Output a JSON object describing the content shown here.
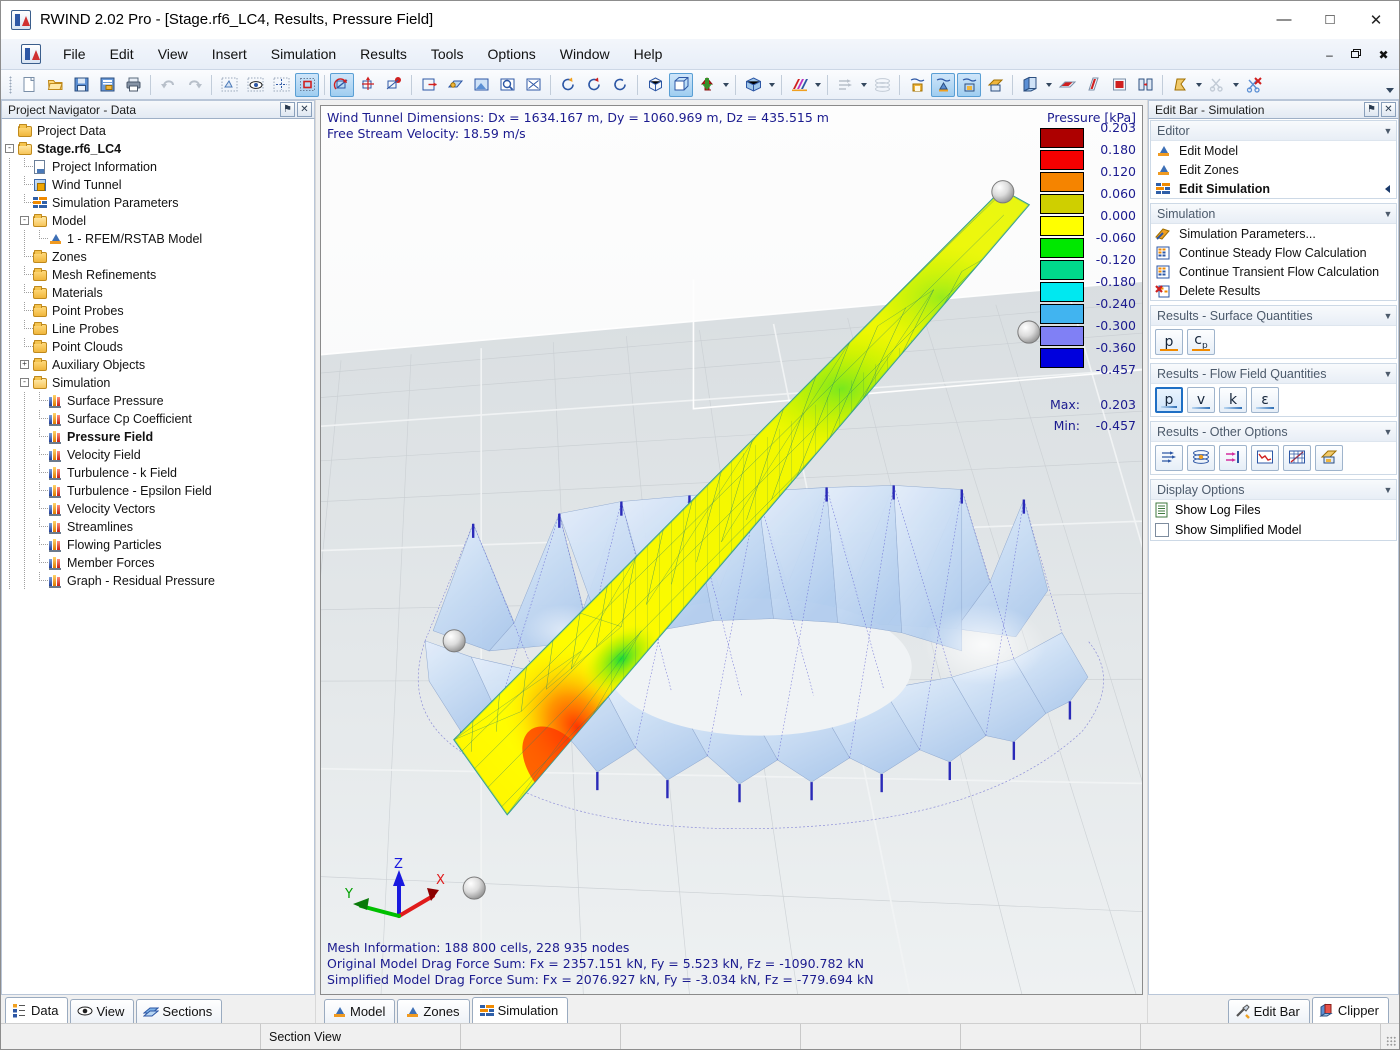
{
  "window": {
    "title": "RWIND 2.02 Pro - [Stage.rf6_LC4, Results, Pressure Field]",
    "app_icon": "rwind-icon",
    "minimize": "—",
    "maximize": "□",
    "close": "✕"
  },
  "mdi": {
    "minimize": "–",
    "restore": "❐",
    "close": "✖"
  },
  "menu": {
    "items": [
      {
        "label": "File"
      },
      {
        "label": "Edit"
      },
      {
        "label": "View"
      },
      {
        "label": "Insert"
      },
      {
        "label": "Simulation"
      },
      {
        "label": "Results"
      },
      {
        "label": "Tools"
      },
      {
        "label": "Options"
      },
      {
        "label": "Window"
      },
      {
        "label": "Help"
      }
    ]
  },
  "toolbar": {
    "groups": [
      {
        "buttons": [
          {
            "name": "new-file-button",
            "icon": "new-document-icon",
            "state": "normal"
          },
          {
            "name": "open-file-button",
            "icon": "open-folder-icon",
            "state": "normal"
          },
          {
            "name": "save-button",
            "icon": "floppy-save-icon",
            "state": "normal"
          },
          {
            "name": "save-detail-button",
            "icon": "save-details-icon",
            "state": "normal"
          },
          {
            "name": "print-button",
            "icon": "printer-icon",
            "state": "normal"
          }
        ]
      },
      {
        "buttons": [
          {
            "name": "undo-button",
            "icon": "undo-arrow-icon",
            "state": "disabled"
          },
          {
            "name": "redo-button",
            "icon": "redo-arrow-icon",
            "state": "disabled"
          }
        ]
      },
      {
        "buttons": [
          {
            "name": "select-objects-button",
            "icon": "select-dots-icon",
            "state": "normal"
          },
          {
            "name": "select-visible-button",
            "icon": "select-eye-icon",
            "state": "normal"
          },
          {
            "name": "snap-grid-button",
            "icon": "snap-grid-icon",
            "state": "normal"
          },
          {
            "name": "selection-window-button",
            "icon": "selection-window-icon",
            "state": "active"
          }
        ]
      },
      {
        "buttons": [
          {
            "name": "rotate-view-button",
            "icon": "rotate-axes-icon",
            "state": "active"
          },
          {
            "name": "pan-view-button",
            "icon": "move-axes-icon",
            "state": "normal"
          },
          {
            "name": "orbit-view-button",
            "icon": "orbit-axes-icon",
            "state": "normal"
          }
        ]
      },
      {
        "buttons": [
          {
            "name": "view-box-button",
            "icon": "view-box-icon",
            "state": "normal"
          },
          {
            "name": "render-view-button",
            "icon": "render-shade-icon",
            "state": "normal"
          },
          {
            "name": "zoom-window-button",
            "icon": "zoom-window-icon",
            "state": "normal"
          },
          {
            "name": "zoom-select-button",
            "icon": "zoom-magnifier-icon",
            "state": "normal"
          },
          {
            "name": "zoom-all-button",
            "icon": "zoom-fit-icon",
            "state": "normal"
          }
        ]
      },
      {
        "buttons": [
          {
            "name": "rotate-left-button",
            "icon": "rotate-ccw-icon",
            "state": "normal"
          },
          {
            "name": "rotate-right-button",
            "icon": "rotate-cw-icon",
            "state": "normal"
          },
          {
            "name": "rotate-reset-button",
            "icon": "rotate-reset-icon",
            "state": "normal"
          }
        ]
      },
      {
        "buttons": [
          {
            "name": "iso-view-button",
            "icon": "isometric-cube-icon",
            "state": "normal"
          },
          {
            "name": "perspective-view-button",
            "icon": "perspective-cube-icon",
            "state": "active"
          },
          {
            "name": "view-direction-button",
            "icon": "view-direction-icon",
            "state": "normal",
            "dropdown": true
          }
        ]
      },
      {
        "buttons": [
          {
            "name": "display-cube-button",
            "icon": "display-cube-icon",
            "state": "normal",
            "dropdown": true
          }
        ]
      },
      {
        "buttons": [
          {
            "name": "color-scale-button",
            "icon": "color-stripes-icon",
            "state": "normal",
            "dropdown": true
          }
        ]
      },
      {
        "buttons": [
          {
            "name": "flow-arrows-button",
            "icon": "flow-arrows-icon",
            "state": "disabled",
            "dropdown": true
          },
          {
            "name": "streamlines-button",
            "icon": "streamline-layers-icon",
            "state": "disabled"
          }
        ]
      },
      {
        "buttons": [
          {
            "name": "show-model-button",
            "icon": "model-wind-icon",
            "state": "normal"
          },
          {
            "name": "show-supports-button",
            "icon": "supports-wind-icon",
            "state": "active"
          },
          {
            "name": "show-zones-button",
            "icon": "zones-wind-icon",
            "state": "active"
          },
          {
            "name": "render-results-button",
            "icon": "render-results-icon",
            "state": "normal"
          }
        ]
      },
      {
        "buttons": [
          {
            "name": "clipper-box-button",
            "icon": "clipper-box-icon",
            "state": "normal",
            "dropdown": true
          },
          {
            "name": "section-plane-xy-button",
            "icon": "plane-xy-icon",
            "state": "normal"
          },
          {
            "name": "section-plane-yz-button",
            "icon": "plane-yz-icon",
            "state": "normal"
          },
          {
            "name": "section-plane-xz-button",
            "icon": "plane-xz-icon",
            "state": "normal"
          },
          {
            "name": "section-move-button",
            "icon": "section-move-icon",
            "state": "normal"
          }
        ]
      },
      {
        "buttons": [
          {
            "name": "clip-shape-button",
            "icon": "clip-shape-icon",
            "state": "normal",
            "dropdown": true
          },
          {
            "name": "cut-tool-button",
            "icon": "scissors-icon",
            "state": "disabled",
            "dropdown": true
          },
          {
            "name": "delete-cut-button",
            "icon": "delete-scissors-icon",
            "state": "normal"
          }
        ]
      }
    ],
    "overflow": "overflow-chevron-icon"
  },
  "navigator": {
    "caption": "Project Navigator - Data",
    "pin_glyph": "⚑",
    "close_glyph": "✕",
    "tree": [
      {
        "label": "Project Data",
        "depth": 0,
        "icon": "folder-icon",
        "expander": "",
        "bold": false
      },
      {
        "label": "Stage.rf6_LC4",
        "depth": 0,
        "icon": "folder-open-icon",
        "expander": "-",
        "bold": true
      },
      {
        "label": "Project Information",
        "depth": 1,
        "icon": "document-icon",
        "expander": "",
        "bold": false
      },
      {
        "label": "Wind Tunnel",
        "depth": 1,
        "icon": "wind-tunnel-cube-icon",
        "expander": "",
        "bold": false
      },
      {
        "label": "Simulation Parameters",
        "depth": 1,
        "icon": "simulation-params-icon",
        "expander": "",
        "bold": false
      },
      {
        "label": "Model",
        "depth": 1,
        "icon": "folder-open-icon",
        "expander": "-",
        "bold": false
      },
      {
        "label": "1 - RFEM/RSTAB Model",
        "depth": 2,
        "icon": "support-icon",
        "expander": "",
        "bold": false
      },
      {
        "label": "Zones",
        "depth": 1,
        "icon": "folder-icon",
        "expander": "",
        "bold": false
      },
      {
        "label": "Mesh Refinements",
        "depth": 1,
        "icon": "folder-icon",
        "expander": "",
        "bold": false
      },
      {
        "label": "Materials",
        "depth": 1,
        "icon": "folder-icon",
        "expander": "",
        "bold": false
      },
      {
        "label": "Point Probes",
        "depth": 1,
        "icon": "folder-icon",
        "expander": "",
        "bold": false
      },
      {
        "label": "Line Probes",
        "depth": 1,
        "icon": "folder-icon",
        "expander": "",
        "bold": false
      },
      {
        "label": "Point Clouds",
        "depth": 1,
        "icon": "folder-icon",
        "expander": "",
        "bold": false
      },
      {
        "label": "Auxiliary Objects",
        "depth": 1,
        "icon": "folder-icon",
        "expander": "+",
        "bold": false
      },
      {
        "label": "Simulation",
        "depth": 1,
        "icon": "folder-open-icon",
        "expander": "-",
        "bold": false
      },
      {
        "label": "Surface Pressure",
        "depth": 2,
        "icon": "result-bars-icon",
        "expander": "",
        "bold": false
      },
      {
        "label": "Surface Cp Coefficient",
        "depth": 2,
        "icon": "result-bars-icon",
        "expander": "",
        "bold": false
      },
      {
        "label": "Pressure Field",
        "depth": 2,
        "icon": "result-bars-icon",
        "expander": "",
        "bold": true
      },
      {
        "label": "Velocity Field",
        "depth": 2,
        "icon": "result-bars-icon",
        "expander": "",
        "bold": false
      },
      {
        "label": "Turbulence - k Field",
        "depth": 2,
        "icon": "result-bars-icon",
        "expander": "",
        "bold": false
      },
      {
        "label": "Turbulence - Epsilon Field",
        "depth": 2,
        "icon": "result-bars-icon",
        "expander": "",
        "bold": false
      },
      {
        "label": "Velocity Vectors",
        "depth": 2,
        "icon": "result-bars-icon",
        "expander": "",
        "bold": false
      },
      {
        "label": "Streamlines",
        "depth": 2,
        "icon": "result-bars-icon",
        "expander": "",
        "bold": false
      },
      {
        "label": "Flowing Particles",
        "depth": 2,
        "icon": "result-bars-icon",
        "expander": "",
        "bold": false
      },
      {
        "label": "Member Forces",
        "depth": 2,
        "icon": "result-bars-icon",
        "expander": "",
        "bold": false
      },
      {
        "label": "Graph - Residual Pressure",
        "depth": 2,
        "icon": "result-bars-icon",
        "expander": "",
        "bold": false
      }
    ],
    "tabs": [
      {
        "label": "Data",
        "icon": "tree-data-icon",
        "selected": true
      },
      {
        "label": "View",
        "icon": "eye-view-icon",
        "selected": false
      },
      {
        "label": "Sections",
        "icon": "sections-layers-icon",
        "selected": false
      }
    ]
  },
  "viewport": {
    "top_lines": [
      "Wind Tunnel Dimensions: Dx = 1634.167 m, Dy = 1060.969 m, Dz = 435.515 m",
      "Free Stream Velocity: 18.59 m/s"
    ],
    "bottom_lines": [
      "Mesh Information: 188 800 cells, 228 935 nodes",
      "Original Model Drag Force Sum: Fx = 2357.151 kN, Fy = 5.523 kN, Fz = -1090.782 kN",
      "Simplified Model Drag Force Sum: Fx = 2076.927 kN, Fy = -3.034 kN, Fz = -779.694 kN"
    ],
    "axes": {
      "x": "X",
      "y": "Y",
      "z": "Z",
      "x_color": "#e01b1b",
      "y_color": "#00c000",
      "z_color": "#1a1adf"
    },
    "tabs": [
      {
        "label": "Model",
        "icon": "model-support-icon",
        "selected": false
      },
      {
        "label": "Zones",
        "icon": "zones-support-icon",
        "selected": false
      },
      {
        "label": "Simulation",
        "icon": "simulation-bars-icon",
        "selected": true
      }
    ]
  },
  "chart_data": {
    "type": "heatmap",
    "title": "Pressure [kPa]",
    "unit": "kPa",
    "quantity": "Pressure",
    "max": 0.203,
    "min": -0.457,
    "max_label": "Max:",
    "min_label": "Min:",
    "tick_values": [
      "0.203",
      "0.180",
      "0.120",
      "0.060",
      "0.000",
      "-0.060",
      "-0.120",
      "-0.180",
      "-0.240",
      "-0.300",
      "-0.360",
      "-0.457"
    ],
    "band_colors": [
      "#ad0000",
      "#f60000",
      "#f58400",
      "#cfcf00",
      "#ffff00",
      "#00e800",
      "#00d98b",
      "#00e8f0",
      "#41b4f0",
      "#8080f5",
      "#0000dd"
    ],
    "bands": [
      {
        "upper": "0.203",
        "lower": "0.180",
        "color": "#ad0000"
      },
      {
        "upper": "0.180",
        "lower": "0.120",
        "color": "#f60000"
      },
      {
        "upper": "0.120",
        "lower": "0.060",
        "color": "#f58400"
      },
      {
        "upper": "0.060",
        "lower": "0.000",
        "color": "#cfcf00"
      },
      {
        "upper": "0.000",
        "lower": "-0.060",
        "color": "#ffff00"
      },
      {
        "upper": "-0.060",
        "lower": "-0.120",
        "color": "#00e800"
      },
      {
        "upper": "-0.120",
        "lower": "-0.180",
        "color": "#00d98b"
      },
      {
        "upper": "-0.180",
        "lower": "-0.240",
        "color": "#00e8f0"
      },
      {
        "upper": "-0.240",
        "lower": "-0.300",
        "color": "#41b4f0"
      },
      {
        "upper": "-0.300",
        "lower": "-0.360",
        "color": "#8080f5"
      },
      {
        "upper": "-0.360",
        "lower": "-0.457",
        "color": "#0000dd"
      }
    ]
  },
  "editbar": {
    "caption": "Edit Bar - Simulation",
    "pin_glyph": "⚑",
    "close_glyph": "✕",
    "groups": [
      {
        "title": "Editor",
        "kind": "rows",
        "rows": [
          {
            "label": "Edit Model",
            "icon": "support-icon",
            "bold": false,
            "arrow": false
          },
          {
            "label": "Edit Zones",
            "icon": "support-icon",
            "bold": false,
            "arrow": false
          },
          {
            "label": "Edit Simulation",
            "icon": "simulation-params-icon",
            "bold": true,
            "arrow": true
          }
        ]
      },
      {
        "title": "Simulation",
        "kind": "rows",
        "rows": [
          {
            "label": "Simulation Parameters...",
            "icon": "params-palette-icon",
            "bold": false,
            "arrow": false
          },
          {
            "label": "Continue Steady Flow Calculation",
            "icon": "calc-grid-icon",
            "bold": false,
            "arrow": false
          },
          {
            "label": "Continue Transient Flow Calculation",
            "icon": "calc-grid-icon",
            "bold": false,
            "arrow": false
          },
          {
            "label": "Delete Results",
            "icon": "delete-results-icon",
            "bold": false,
            "arrow": false
          }
        ]
      },
      {
        "title": "Results - Surface Quantities",
        "kind": "quantity-buttons",
        "buttons": [
          {
            "name": "surface-pressure-button",
            "symbol": "p",
            "sub": "",
            "selected": false,
            "underline": "orange"
          },
          {
            "name": "surface-cp-button",
            "symbol": "c",
            "sub": "p",
            "selected": false,
            "underline": "orange"
          }
        ]
      },
      {
        "title": "Results - Flow Field Quantities",
        "kind": "quantity-buttons",
        "buttons": [
          {
            "name": "flow-pressure-button",
            "symbol": "p",
            "sub": "",
            "selected": true,
            "underline": "blue"
          },
          {
            "name": "flow-velocity-button",
            "symbol": "v",
            "sub": "",
            "selected": false,
            "underline": "blue"
          },
          {
            "name": "flow-k-button",
            "symbol": "k",
            "sub": "",
            "selected": false,
            "underline": "blue"
          },
          {
            "name": "flow-epsilon-button",
            "symbol": "ε",
            "sub": "",
            "selected": false,
            "underline": "blue"
          }
        ]
      },
      {
        "title": "Results - Other Options",
        "kind": "option-buttons",
        "buttons": [
          {
            "name": "velocity-vectors-button",
            "icon": "flow-arrows-icon"
          },
          {
            "name": "streamlines-button",
            "icon": "streamline-layers-icon"
          },
          {
            "name": "flowing-particles-button",
            "icon": "particles-arrow-icon"
          },
          {
            "name": "residual-graph-button",
            "icon": "residual-graph-icon"
          },
          {
            "name": "member-forces-button",
            "icon": "member-forces-icon"
          },
          {
            "name": "result-display-button",
            "icon": "result-display-icon"
          }
        ]
      },
      {
        "title": "Display Options",
        "kind": "checkboxes",
        "rows": [
          {
            "label": "Show Log Files",
            "control": "document-icon",
            "checked": false
          },
          {
            "label": "Show Simplified Model",
            "control": "checkbox",
            "checked": false
          }
        ]
      }
    ],
    "tabs": [
      {
        "label": "Edit Bar",
        "icon": "tools-icon",
        "selected": false
      },
      {
        "label": "Clipper",
        "icon": "clipper-box-icon",
        "selected": true
      }
    ]
  },
  "statusbar": {
    "cells": [
      "",
      "Section View",
      "",
      "",
      "",
      "",
      ""
    ],
    "grip": "resize-grip-icon"
  }
}
